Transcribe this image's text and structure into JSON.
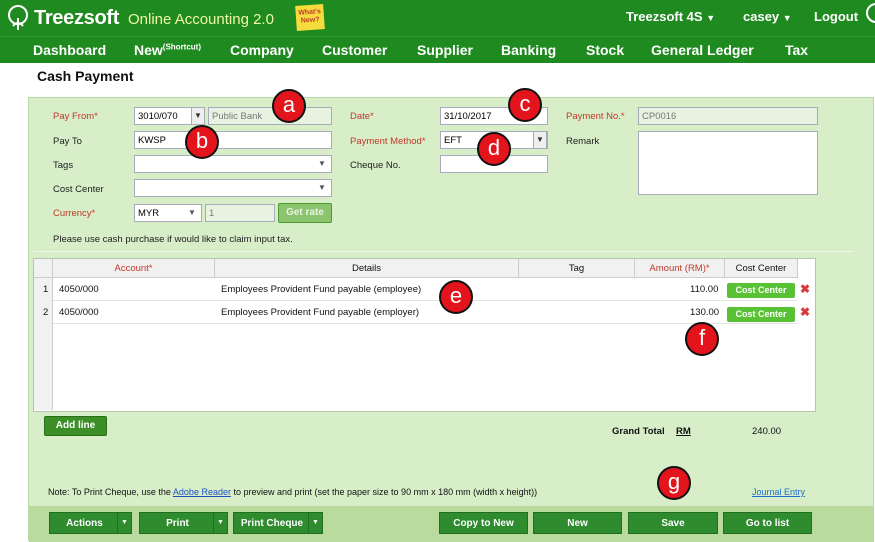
{
  "app": {
    "name": "Treezsoft",
    "product": "Online Accounting 2.0",
    "note": "What's New?"
  },
  "header": {
    "company": "Treezsoft 4S",
    "user": "casey",
    "logout": "Logout"
  },
  "nav": [
    "Dashboard",
    "New",
    "Company",
    "Customer",
    "Supplier",
    "Banking",
    "Stock",
    "General Ledger",
    "Tax"
  ],
  "nav_new_sup": "(Shortcut)",
  "page": {
    "title": "Cash Payment"
  },
  "form": {
    "pay_from_label": "Pay From*",
    "pay_from": "3010/070",
    "pay_from_name": "Public Bank",
    "pay_to_label": "Pay To",
    "pay_to": "KWSP",
    "tags_label": "Tags",
    "tags": "",
    "cost_center_label": "Cost Center",
    "cost_center": "",
    "currency_label": "Currency*",
    "currency": "MYR",
    "rate": "1",
    "get_rate": "Get rate",
    "date_label": "Date*",
    "date": "31/10/2017",
    "payment_method_label": "Payment Method*",
    "payment_method": "EFT",
    "cheque_no_label": "Cheque No.",
    "cheque_no": "",
    "payment_no_label": "Payment No.*",
    "payment_no": "CP0016",
    "remark_label": "Remark",
    "remark": "",
    "notice": "Please use cash purchase if would like to claim input tax."
  },
  "grid": {
    "columns": [
      "Account*",
      "Details",
      "Tag",
      "Amount (RM)*",
      "Cost Center"
    ],
    "rows": [
      {
        "no": "1",
        "account": "4050/000",
        "details": "Employees Provident Fund payable (employee)",
        "tag": "",
        "amount": "110.00",
        "cost_center": "Cost Center"
      },
      {
        "no": "2",
        "account": "4050/000",
        "details": "Employees Provident Fund payable (employer)",
        "tag": "",
        "amount": "130.00",
        "cost_center": "Cost Center"
      }
    ]
  },
  "add_line": "Add line",
  "totals": {
    "label": "Grand Total",
    "currency": "RM",
    "value": "240.00"
  },
  "footer": {
    "note_prefix": "Note: To Print Cheque, use the ",
    "link": "Adobe Reader",
    "note_suffix": " to preview and print (set the paper size to 90 mm x 180 mm (width x height))",
    "journal": "Journal Entry"
  },
  "buttons": {
    "actions": "Actions",
    "print": "Print",
    "print_cheque": "Print Cheque",
    "copy_to_new": "Copy to New",
    "new": "New",
    "save": "Save",
    "go_to_list": "Go to list"
  },
  "markers": [
    "a",
    "b",
    "c",
    "d",
    "e",
    "f",
    "g"
  ],
  "colors": {
    "brand_green": "#1f8a1f",
    "panel": "#d7eec8",
    "marker_red": "#e3141c",
    "required": "#c0392b"
  }
}
